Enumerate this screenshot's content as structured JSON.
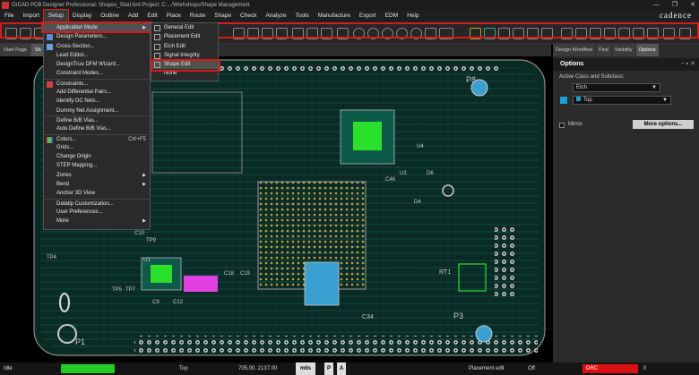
{
  "window": {
    "title": "OrCAD PCB Designer Professional: Shapes_Start.brd  Project: C:.../Workshops/Shape Management",
    "controls": [
      "—",
      "❐",
      "✕"
    ]
  },
  "menubar": {
    "items": [
      "File",
      "Import",
      "Setup",
      "Display",
      "Outline",
      "Add",
      "Edit",
      "Place",
      "Route",
      "Shape",
      "Check",
      "Analyze",
      "Tools",
      "Manufacture",
      "Export",
      "EDM",
      "Help"
    ],
    "active": "Setup"
  },
  "logo": "cadence",
  "tabs": [
    "Start Page",
    "Sh"
  ],
  "setup_menu": {
    "items": [
      {
        "label": "Application Mode",
        "submenu": true,
        "highlight": true
      },
      {
        "label": "Design Parameters..."
      },
      {
        "label": "Cross-Section..."
      },
      {
        "label": "Lead Editor..."
      },
      {
        "label": "DesignTrue DFM Wizard..."
      },
      {
        "label": "Constraint Modes..."
      },
      {
        "label": "Constraints..."
      },
      {
        "label": "Add Differential Pairs..."
      },
      {
        "label": "Identify DC Nets..."
      },
      {
        "label": "Dummy Net Assignment..."
      },
      {
        "label": "Define B/B Vias..."
      },
      {
        "label": "Auto Define B/B Vias..."
      },
      {
        "label": "Colors...",
        "shortcut": "Ctrl+F5"
      },
      {
        "label": "Grids..."
      },
      {
        "label": "Change Origin"
      },
      {
        "label": "STEP Mapping..."
      },
      {
        "label": "Zones",
        "submenu": true
      },
      {
        "label": "Bend",
        "submenu": true
      },
      {
        "label": "Anchor 3D View"
      },
      {
        "label": "Datatip Customization..."
      },
      {
        "label": "User Preferences..."
      },
      {
        "label": "More",
        "submenu": true
      }
    ]
  },
  "app_mode_menu": {
    "items": [
      {
        "label": "General Edit"
      },
      {
        "label": "Placement Edit"
      },
      {
        "label": "Etch Edit"
      },
      {
        "label": "Signal Integrity"
      },
      {
        "label": "Shape Edit",
        "highlight": true
      },
      {
        "label": "None"
      }
    ]
  },
  "right_panel": {
    "tabs": [
      "Design Workflow",
      "Find",
      "Visibility",
      "Options"
    ],
    "active_tab": "Options",
    "title": "Options",
    "title_controls": "− ▪ ✕",
    "active_class_label": "Active Class and Subclass:",
    "class_value": "Etch",
    "subclass_value": "Top",
    "mirror_label": "Mirror",
    "more_options_label": "More options..."
  },
  "statusbar": {
    "state": "Idle",
    "layer": "Top",
    "coords": "705.00, 2137.00",
    "units": "mils",
    "p_btn": "P",
    "a_btn": "A",
    "mode": "Placement edit",
    "off": "Off",
    "drc": "DRC",
    "count": "0"
  },
  "board_labels": [
    "P8",
    "P1",
    "P3",
    "TP5",
    "TP7",
    "TP9",
    "TP4",
    "C9",
    "C12",
    "C34",
    "RT1",
    "U1",
    "U3",
    "U4",
    "C18",
    "C19",
    "D4",
    "D6",
    "C46",
    "C10"
  ],
  "colors": {
    "accent_red": "#d61c1c",
    "board_copper": "#1a5f4e",
    "green_highlight": "#22dd22",
    "pink_component": "#e040e0",
    "status_green": "#22cc22",
    "status_red": "#dd1111"
  }
}
